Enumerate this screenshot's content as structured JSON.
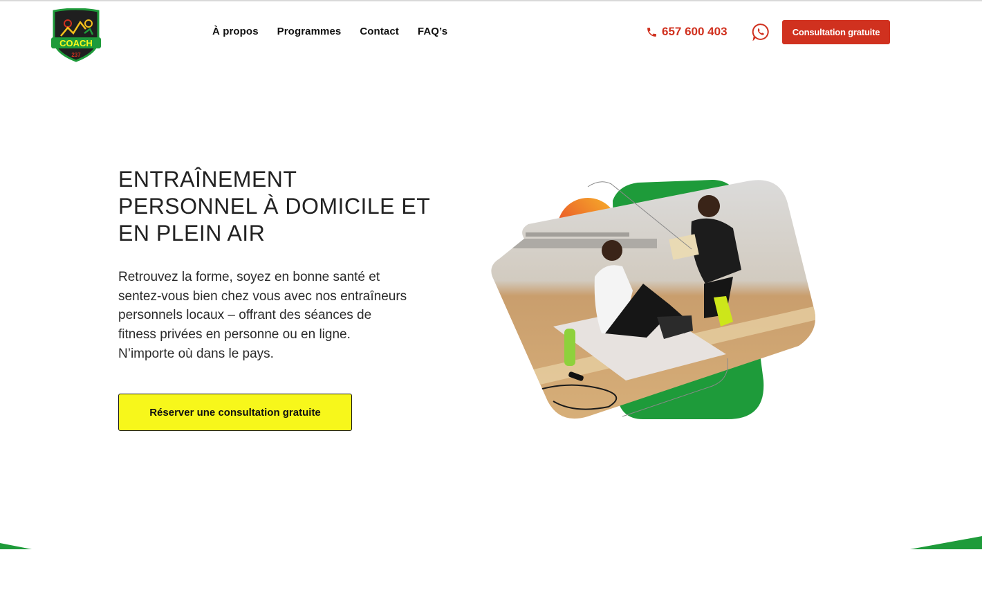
{
  "brand": {
    "logo_text": "COACH",
    "logo_subtext": "237"
  },
  "nav": {
    "items": [
      {
        "label": "À propos"
      },
      {
        "label": "Programmes"
      },
      {
        "label": "Contact"
      },
      {
        "label": "FAQ’s"
      }
    ]
  },
  "header": {
    "phone": "657 600 403",
    "cta_label": "Consultation gratuite"
  },
  "hero": {
    "title_lines": [
      "ENTRAÎNEMENT",
      "PERSONNEL À DOMICILE ET",
      "EN PLEIN AIR"
    ],
    "text_lines": [
      "Retrouvez la forme, soyez en bonne santé et",
      "sentez-vous bien chez vous avec nos entraîneurs",
      "personnels locaux – offrant des séances de",
      "fitness privées en personne ou en ligne.",
      "N’importe où dans le pays."
    ],
    "cta_label": "Réserver une consultation gratuite"
  },
  "colors": {
    "accent_red": "#d0311f",
    "accent_green": "#1e9b3a",
    "accent_yellow": "#f7f71b"
  },
  "icons": {
    "phone": "phone-icon",
    "whatsapp": "whatsapp-icon"
  }
}
